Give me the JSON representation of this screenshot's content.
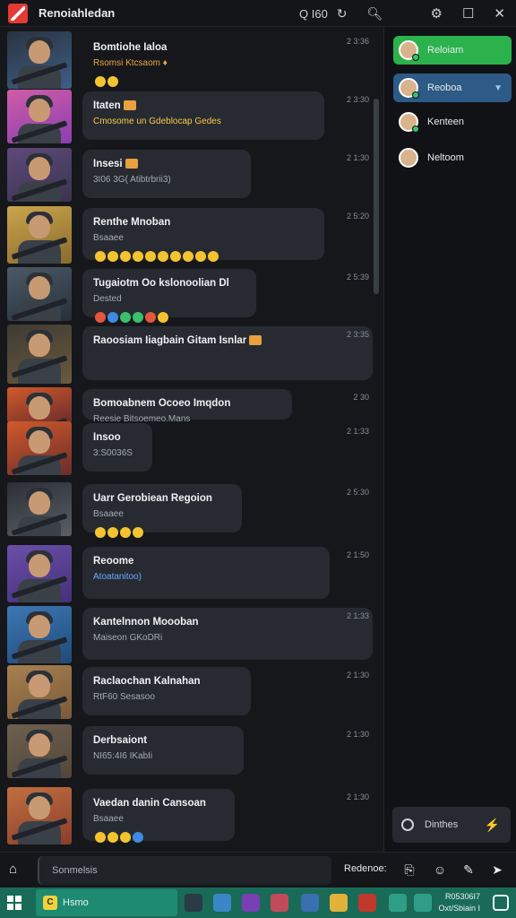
{
  "window": {
    "title": "Renoiahledan",
    "search_label": "Q I60",
    "controls": [
      "minimize",
      "maximize",
      "close"
    ]
  },
  "messages": [
    {
      "title": "Bomtiohe Ialoa",
      "sub": "Rsomsi Ktcsaom ♦",
      "sub_color": "orange",
      "time": "2 3:36",
      "emojis": [
        "y",
        "y"
      ],
      "avatar_colors": [
        "#3e5f86",
        "#2a3340"
      ],
      "bubble_w": 0
    },
    {
      "title": "Itaten",
      "sub": "Cmosome un Gdeblocap Gedes",
      "sub_color": "yellow",
      "time": "2 3:30",
      "emojis": [],
      "avatar_colors": [
        "#8b3fb1",
        "#d05ca6"
      ],
      "bubble_w": 270
    },
    {
      "title": "Insesi",
      "sub": "3I06 3G( Atibtrbrii3)",
      "sub_color": "grey",
      "time": "2 1:30",
      "emojis": [],
      "avatar_colors": [
        "#3b3350",
        "#5e4a79"
      ],
      "bubble_w": 188
    },
    {
      "title": "Renthe Mnoban",
      "sub": "Bsaaee",
      "sub_color": "grey",
      "time": "2 5:20",
      "emojis": [
        "y",
        "y",
        "y",
        "y",
        "y",
        "y",
        "y",
        "y",
        "y",
        "y"
      ],
      "avatar_colors": [
        "#8a6a2c",
        "#c9a54c"
      ],
      "bubble_w": 270
    },
    {
      "title": "Tugaiotm Oo kslonoolian Dl",
      "sub": "Dested",
      "sub_color": "grey",
      "time": "2 5:39",
      "emojis": [
        "r",
        "b",
        "g",
        "g",
        "r",
        "y"
      ],
      "avatar_colors": [
        "#26303a",
        "#4b5a66"
      ],
      "bubble_w": 194
    },
    {
      "title": "Raoosiam Iiagbain Gitam Isnlar",
      "sub": "",
      "sub_color": "grey",
      "time": "2 3:35",
      "emojis": [],
      "avatar_colors": [
        "#6a5a3c",
        "#3e3a34"
      ],
      "bubble_w": 324
    },
    {
      "title": "Bomoabnem Ocoeo Imqdon",
      "sub": "Reesie Bitsoemeo.Mans",
      "sub_color": "grey",
      "time": "2 30",
      "emojis": [],
      "avatar_colors": [
        "#6a2c2c",
        "#d15a2a"
      ],
      "bubble_w": 234
    },
    {
      "title": "Insoo",
      "sub": "3:S0036S",
      "sub_color": "grey",
      "time": "2 1:33",
      "emojis": [],
      "avatar_colors": [
        "#6a2c2c",
        "#d15a2a"
      ],
      "bubble_w": 78
    },
    {
      "title": "Uarr Gerobiean Regoion",
      "sub": "Bsaaee",
      "sub_color": "grey",
      "time": "2 5:30",
      "emojis": [
        "y",
        "y",
        "y",
        "y"
      ],
      "avatar_colors": [
        "#5a5f66",
        "#2b2f35"
      ],
      "bubble_w": 178
    },
    {
      "title": "Reoome",
      "sub": "Atoatanitoo)",
      "sub_color": "blue",
      "time": "2 1:50",
      "emojis": [],
      "avatar_colors": [
        "#45307a",
        "#6b4fa8"
      ],
      "bubble_w": 276
    },
    {
      "title": "Kantelnnon Moooban",
      "sub": "Maiseon GKoDRi",
      "sub_color": "grey",
      "time": "2 1:33",
      "emojis": [],
      "avatar_colors": [
        "#1f4a7a",
        "#3e77b3"
      ],
      "bubble_w": 324
    },
    {
      "title": "Raclaochan Kalnahan",
      "sub": "RtF60 Sesasoo",
      "sub_color": "grey",
      "time": "2 1:30",
      "emojis": [],
      "avatar_colors": [
        "#7a5a3a",
        "#a7804f"
      ],
      "bubble_w": 188
    },
    {
      "title": "Derbsaiont",
      "sub": "NI65:4I6 IKabIi",
      "sub_color": "grey",
      "time": "2 1:30",
      "emojis": [],
      "avatar_colors": [
        "#52463a",
        "#6e604f"
      ],
      "bubble_w": 180
    },
    {
      "title": "Vaedan danin Cansoan",
      "sub": "Bsaaee",
      "sub_color": "grey",
      "time": "2 1:30",
      "emojis": [
        "y",
        "y",
        "y",
        "b"
      ],
      "avatar_colors": [
        "#8a3d2a",
        "#c07040"
      ],
      "bubble_w": 170
    }
  ],
  "side": {
    "contacts": [
      {
        "label": "Reloiam",
        "style": "green",
        "status_color": "#38c172"
      },
      {
        "label": "Reoboa",
        "style": "blue",
        "status_color": "#38c172"
      },
      {
        "label": "Kenteen",
        "style": "plain",
        "status_color": "#38c172"
      },
      {
        "label": "Neltoom",
        "style": "plain",
        "status_color": ""
      }
    ],
    "search_placeholder": "Dinthes"
  },
  "composer": {
    "placeholder": "Sonmelsis",
    "action_label": "Redenoe:"
  },
  "taskbar": {
    "search_text": "Hsmo",
    "clock_line1": "R05306I7",
    "clock_line2": "Oxt/Sbiain I"
  }
}
